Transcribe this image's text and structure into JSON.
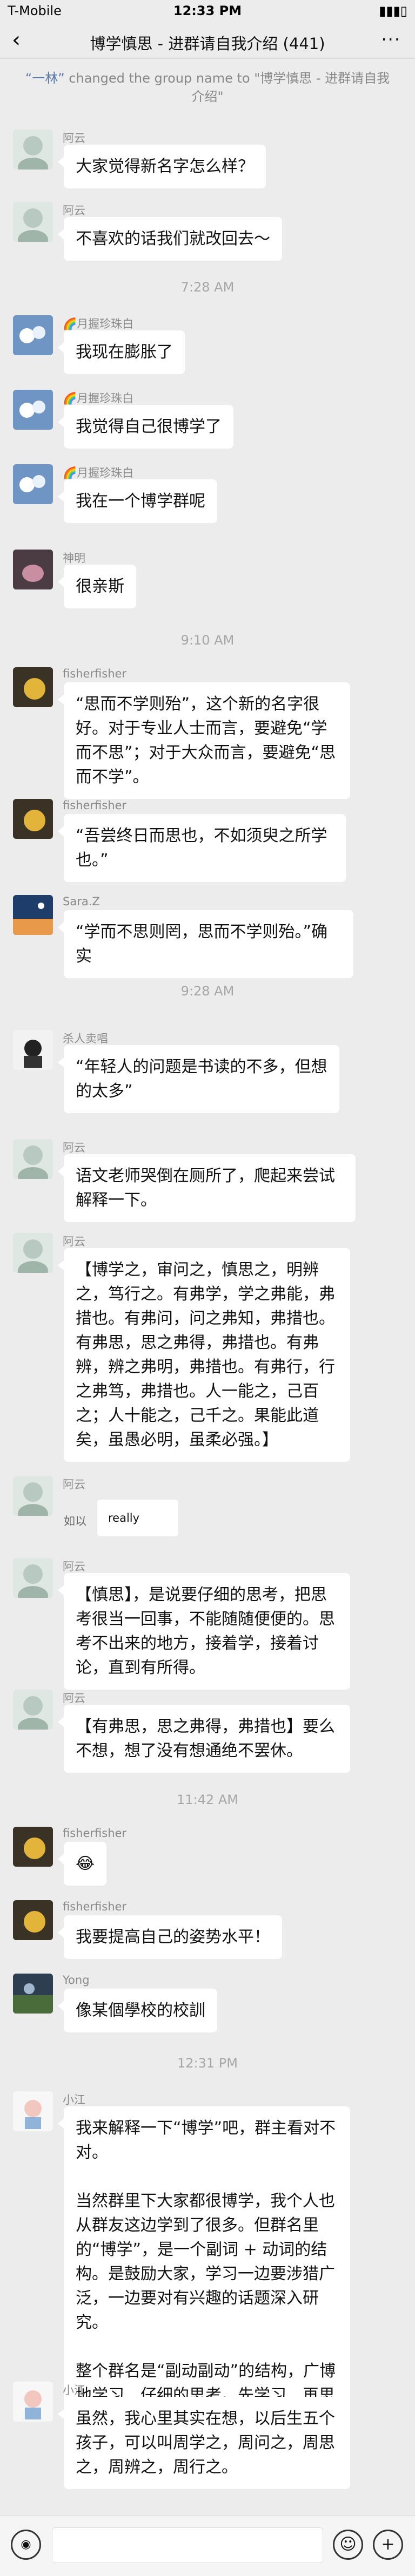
{
  "status": {
    "carrier": "T-Mobile",
    "time": "12:33 PM",
    "battery": "▮▮▮▯"
  },
  "nav": {
    "back": "‹",
    "title": "博学慎思 - 进群请自我介绍 (441)",
    "more": "···"
  },
  "system_message": {
    "name": "“一林”",
    "text": " changed the group name to \"博学慎思 - 进群请自我介绍\""
  },
  "timestamps": [
    "7:28 AM",
    "9:10 AM",
    "9:28 AM",
    "11:42 AM",
    "12:31 PM"
  ],
  "messages": [
    {
      "sender": "阿云",
      "text": "大家觉得新名字怎么样？"
    },
    {
      "sender": "阿云",
      "text": "不喜欢的话我们就改回去～"
    },
    {
      "sender": "🌈月握珍珠白",
      "text": "我现在膨胀了"
    },
    {
      "sender": "🌈月握珍珠白",
      "text": "我觉得自己很博学了"
    },
    {
      "sender": "🌈月握珍珠白",
      "text": "我在一个博学群呢"
    },
    {
      "sender": "神明",
      "text": "很亲斯"
    },
    {
      "sender": "fisherfisher",
      "text": "“思而不学则殆”，这个新的名字很好。对于专业人士而言，要避免“学而不思”；对于大众而言，要避免“思而不学”。"
    },
    {
      "sender": "fisherfisher",
      "text": "“吾尝终日而思也，不如须臾之所学也。”"
    },
    {
      "sender": "Sara.Z",
      "text": "“学而不思则罔，思而不学则殆。”确实"
    },
    {
      "sender": "杀人卖唱",
      "text": "“年轻人的问题是书读的不多，但想的太多”"
    },
    {
      "sender": "阿云",
      "text": "语文老师哭倒在厕所了，爬起来尝试解释一下。"
    },
    {
      "sender": "阿云",
      "text": "【博学之，审问之，慎思之，明辨之，笃行之。有弗学，学之弗能，弗措也。有弗问，问之弗知，弗措也。有弗思，思之弗得，弗措也。有弗辨，辨之弗明，弗措也。有弗行，行之弗笃，弗措也。人一能之，己百之；人十能之，己千之。果能此道矣，虽愚必明，虽柔必强。】"
    },
    {
      "sender": "阿云",
      "quote_label": "如以",
      "quote_text": "really"
    },
    {
      "sender": "阿云",
      "text": "【慎思】，是说要仔细的思考，把思考很当一回事，不能随随便便的。思考不出来的地方，接着学，接着讨论，直到有所得。"
    },
    {
      "sender": "阿云",
      "text": "【有弗思，思之弗得，弗措也】要么不想，想了没有想通绝不罢休。"
    },
    {
      "sender": "fisherfisher",
      "text": "😂"
    },
    {
      "sender": "fisherfisher",
      "text": "我要提高自己的姿势水平！"
    },
    {
      "sender": "Yong",
      "text": "像某個學校的校訓"
    },
    {
      "sender": "小江",
      "text": "我来解释一下“博学”吧，群主看对不对。\n\n当然群里下大家都很博学，我个人也从群友这边学到了很多。但群名里的“博学”，是一个副词 + 动词的结构。是鼓励大家，学习一边要涉猎广泛，一边要对有兴趣的话题深入研究。\n\n整个群名是“副动副动”的结构，广博地学习，仔细的思考。先学习，再思考。"
    },
    {
      "sender": "小江",
      "text": "虽然，我心里其实在想，以后生五个孩子，可以叫周学之，周问之，周思之，周辨之，周行之。"
    }
  ],
  "input": {
    "voice_icon": "voice-icon",
    "emoji_icon": "emoji-icon",
    "plus_icon": "plus-icon"
  }
}
